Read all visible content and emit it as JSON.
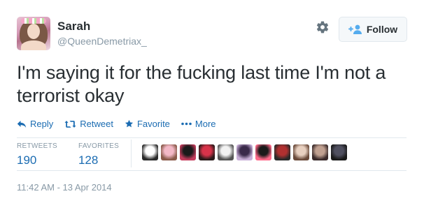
{
  "user": {
    "name": "Sarah",
    "handle": "@QueenDemetriax_",
    "avatar_icon": "profile-avatar-icon"
  },
  "header": {
    "settings_icon": "gear-icon",
    "follow_label": "Follow",
    "follow_icon": "follow-user-plus-icon"
  },
  "tweet": {
    "text": "I'm saying it for the fucking last time I'm not a terrorist okay"
  },
  "actions": [
    {
      "label": "Reply",
      "icon": "reply-arrow-icon"
    },
    {
      "label": "Retweet",
      "icon": "retweet-icon"
    },
    {
      "label": "Favorite",
      "icon": "star-icon"
    },
    {
      "label": "More",
      "icon": "ellipsis-icon"
    }
  ],
  "stats": {
    "retweets_label": "RETWEETS",
    "retweets_value": "190",
    "favorites_label": "FAVORITES",
    "favorites_value": "128"
  },
  "favoriter_avatars": [
    {
      "colors": [
        "#ffffff",
        "#2a2a2a"
      ]
    },
    {
      "colors": [
        "#f3b8c6",
        "#8a5a4a"
      ]
    },
    {
      "colors": [
        "#1a1a1a",
        "#c43c5c"
      ]
    },
    {
      "colors": [
        "#d8334a",
        "#2b1a1a"
      ]
    },
    {
      "colors": [
        "#f2f2f2",
        "#555555"
      ]
    },
    {
      "colors": [
        "#3a2a4a",
        "#c9b0d8"
      ]
    },
    {
      "colors": [
        "#1a1a1a",
        "#ff6a8a"
      ]
    },
    {
      "colors": [
        "#b03030",
        "#2a2a2a"
      ]
    },
    {
      "colors": [
        "#e8d0c0",
        "#6a4a3a"
      ]
    },
    {
      "colors": [
        "#c0a090",
        "#3a2a2a"
      ]
    },
    {
      "colors": [
        "#505060",
        "#1a1a1a"
      ]
    }
  ],
  "meta": {
    "timestamp": "11:42 AM - 13 Apr 2014"
  },
  "colors": {
    "link_blue": "#1b6cb2",
    "text_dark": "#292f33",
    "text_gray": "#8899a6",
    "border": "#e1e8ed"
  }
}
